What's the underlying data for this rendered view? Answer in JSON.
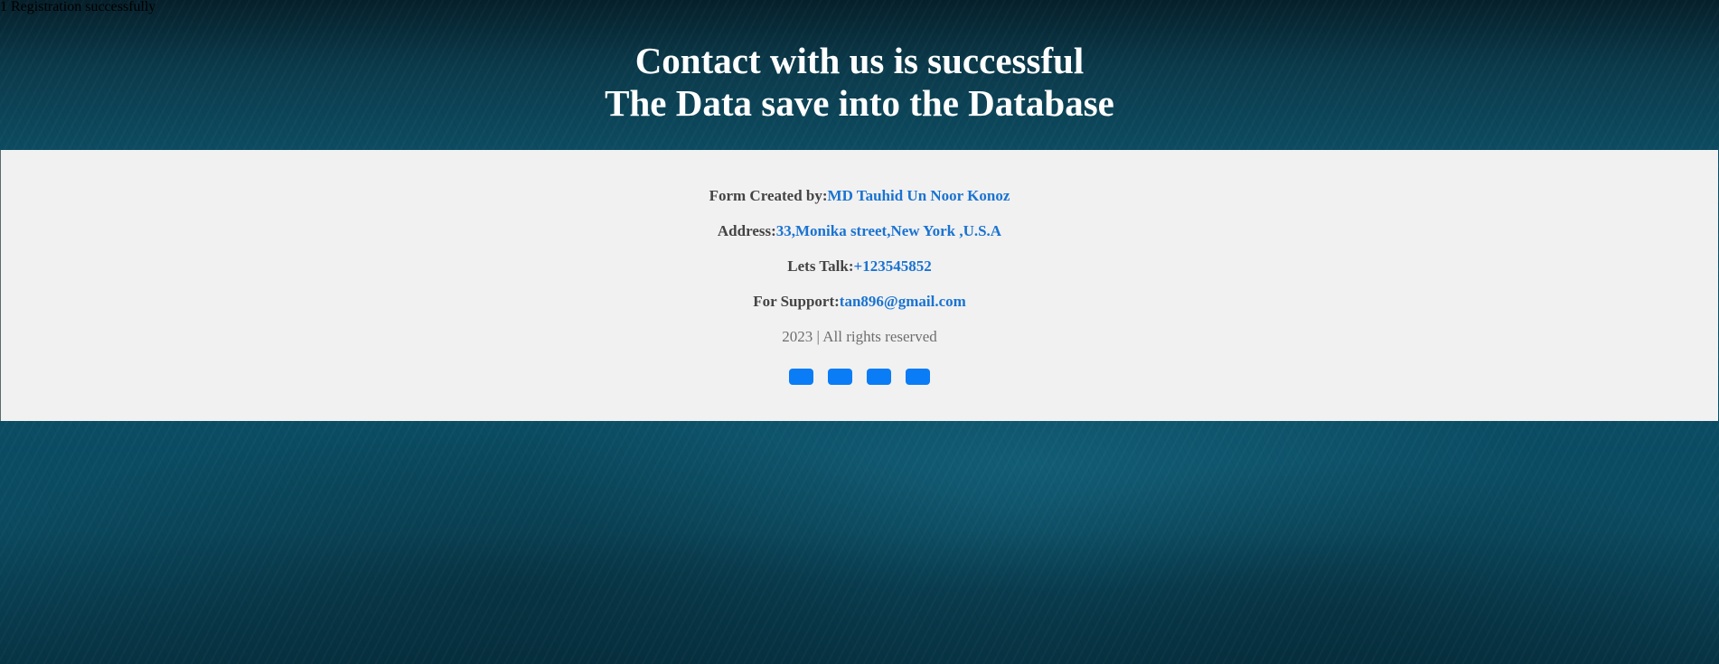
{
  "alert": {
    "message": "1 Registration successfully"
  },
  "hero": {
    "line1": "Contact with us is successful",
    "line2": "The Data save into the Database"
  },
  "footer": {
    "created_by": {
      "label": "Form Created by:",
      "value": "MD Tauhid Un Noor Konoz"
    },
    "address": {
      "label": "Address:",
      "value": "33,Monika street,New York ,U.S.A"
    },
    "lets_talk": {
      "label": "Lets Talk:",
      "value": "+123545852"
    },
    "support": {
      "label": "For Support:",
      "value": "tan896@gmail.com"
    },
    "copyright": "2023 | All rights reserved",
    "social_icons": [
      "social-icon-1",
      "social-icon-2",
      "social-icon-3",
      "social-icon-4"
    ]
  },
  "colors": {
    "link": "#1a73d1",
    "label": "#444444",
    "social_button": "#0a7cf5",
    "panel_background": "#f1f1f1",
    "hero_text": "#ffffff"
  }
}
